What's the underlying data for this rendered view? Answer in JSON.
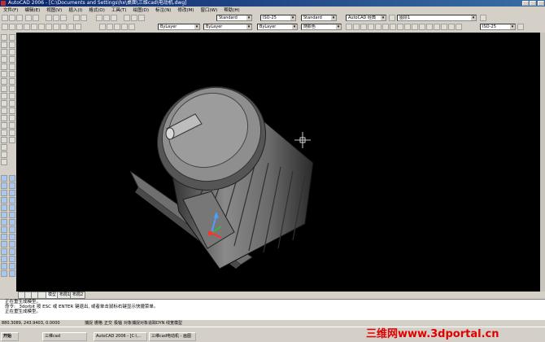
{
  "window": {
    "title": "AutoCAD 2006 - [C:\\Documents and Settings\\hx\\桌面\\三维cad\\电动机.dwg]"
  },
  "menu": {
    "items": [
      "文件(F)",
      "编辑(E)",
      "视图(V)",
      "插入(I)",
      "格式(O)",
      "工具(T)",
      "绘图(D)",
      "标注(N)",
      "修改(M)",
      "窗口(W)",
      "帮助(H)"
    ]
  },
  "toolbar": {
    "text_style": "Standard",
    "dim_style": "ISO-25",
    "table_style": "Standard",
    "workspace": "AutoCAD 经典",
    "layer": "图层1",
    "dim_style2": "ISO-25"
  },
  "properties": {
    "color": "ByLayer",
    "linetype": "ByLayer",
    "lineweight": "ByLayer",
    "plotstyle": "随颜色"
  },
  "tabs": {
    "items": [
      "模型",
      "布局1",
      "布局2"
    ]
  },
  "command": {
    "lines": [
      "正在重生成模型。",
      "命令: _3dorbit 按 ESC 或 ENTER 键退出, 或者单击鼠标右键显示快捷菜单。",
      "正在重生成模型。"
    ]
  },
  "status": {
    "coords": "880.3089, 243.9403, 0.0000",
    "modes": [
      "捕捉",
      "栅格",
      "正交",
      "极轴",
      "对象捕捉",
      "对象追踪",
      "DYN",
      "线宽",
      "模型"
    ]
  },
  "taskbar": {
    "start": "开始",
    "items": [
      "三维cad",
      "AutoCAD 2006 - [C:\\...",
      "三维cad电动机 - 画图"
    ]
  },
  "watermark": "三维网www.3dportal.cn",
  "colors": {
    "titlebar": "#0a246a",
    "canvas": "#000000",
    "watermark": "#e00000"
  }
}
